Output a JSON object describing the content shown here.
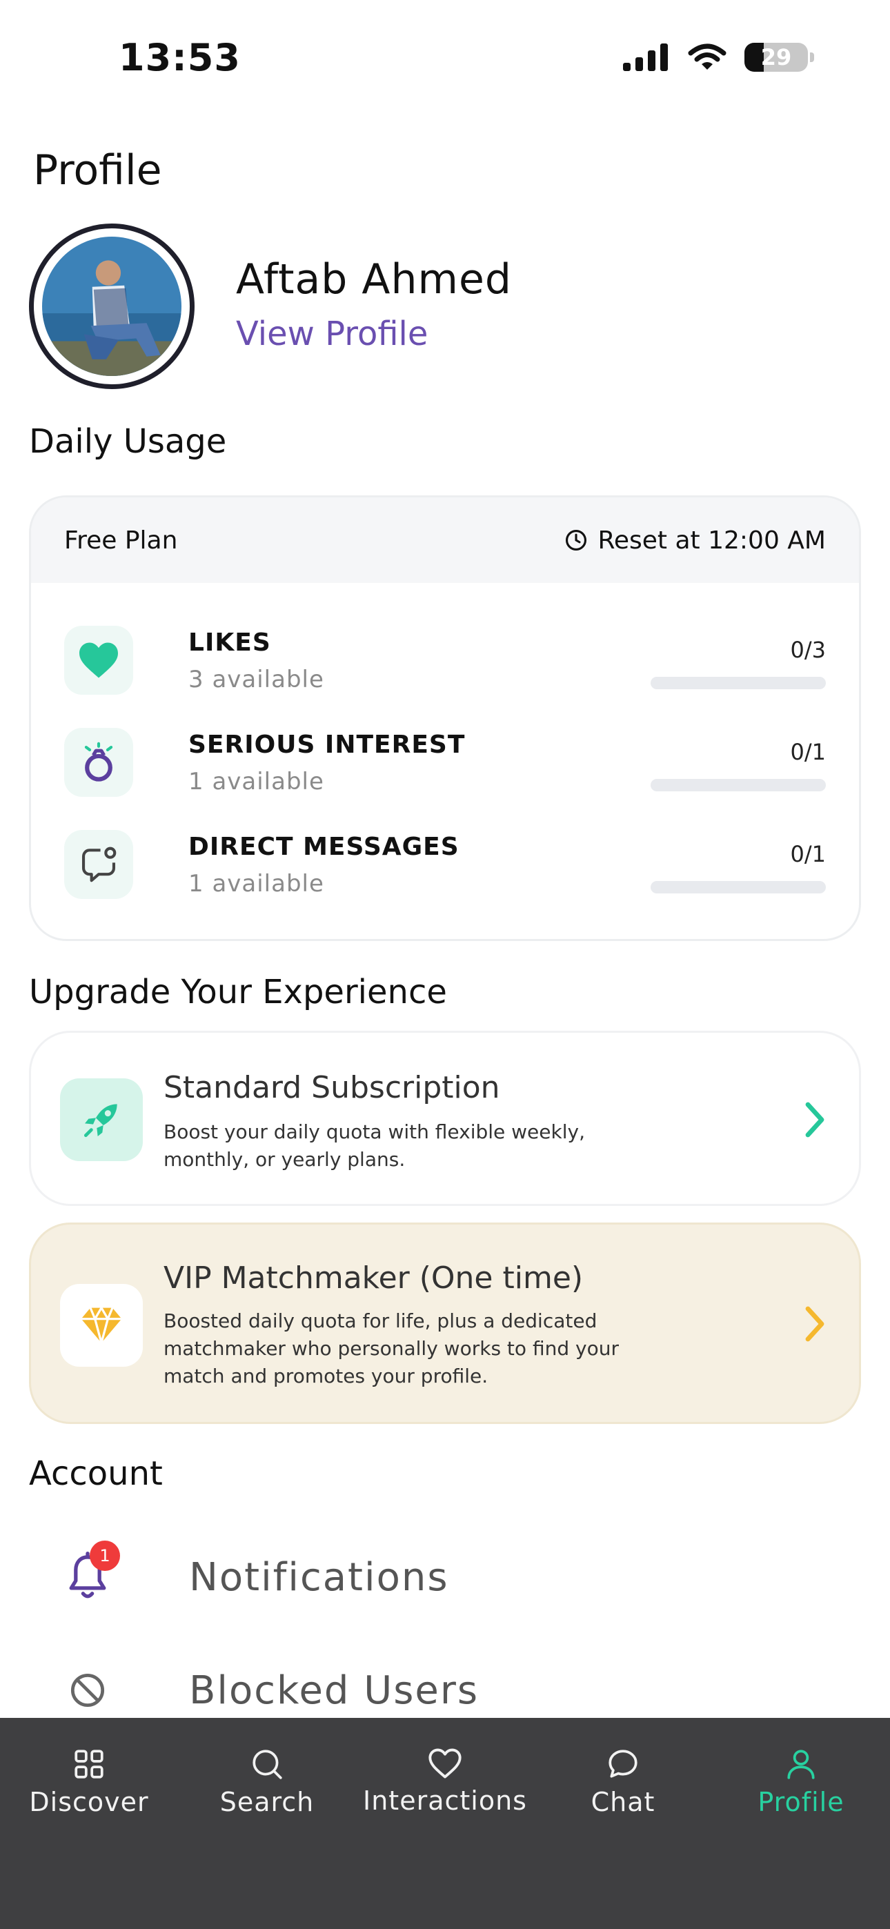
{
  "status_bar": {
    "time": "13:53",
    "battery": "29"
  },
  "header": {
    "title": "Profile"
  },
  "user": {
    "name": "Aftab Ahmed",
    "view_profile": "View Profile"
  },
  "daily_usage": {
    "title": "Daily Usage",
    "plan": "Free Plan",
    "reset": "Reset at 12:00 AM",
    "items": [
      {
        "label": "LIKES",
        "available": "3 available",
        "count": "0/3",
        "progress": 0,
        "icon": "heart-icon"
      },
      {
        "label": "SERIOUS INTEREST",
        "available": "1 available",
        "count": "0/1",
        "progress": 0,
        "icon": "ring-icon"
      },
      {
        "label": "DIRECT MESSAGES",
        "available": "1 available",
        "count": "0/1",
        "progress": 0,
        "icon": "message-icon"
      }
    ]
  },
  "upgrade": {
    "title": "Upgrade Your Experience",
    "plans": [
      {
        "title": "Standard Subscription",
        "description": "Boost your daily quota with flexible weekly, monthly, or yearly plans.",
        "icon": "rocket-icon",
        "accent": "#26c79a"
      },
      {
        "title": "VIP Matchmaker (One time)",
        "description": "Boosted daily quota for life, plus a dedicated matchmaker who personally works to find your match and promotes your profile.",
        "icon": "diamond-icon",
        "accent": "#f5b82e"
      }
    ]
  },
  "account": {
    "title": "Account",
    "items": [
      {
        "label": "Notifications",
        "badge": "1",
        "icon": "bell-icon"
      },
      {
        "label": "Blocked Users",
        "icon": "block-icon"
      }
    ]
  },
  "tabs": [
    {
      "label": "Discover",
      "icon": "grid-icon",
      "active": false
    },
    {
      "label": "Search",
      "icon": "search-icon",
      "active": false
    },
    {
      "label": "Interactions",
      "icon": "heart-outline-icon",
      "active": false
    },
    {
      "label": "Chat",
      "icon": "chat-bubble-icon",
      "active": false
    },
    {
      "label": "Profile",
      "icon": "person-icon",
      "active": true
    }
  ],
  "colors": {
    "accent": "#28d1a0",
    "link": "#6a4fb0",
    "tabbar": "#3f3f41",
    "badge": "#ef3b3b",
    "vip_bg": "#f6f0e2"
  }
}
